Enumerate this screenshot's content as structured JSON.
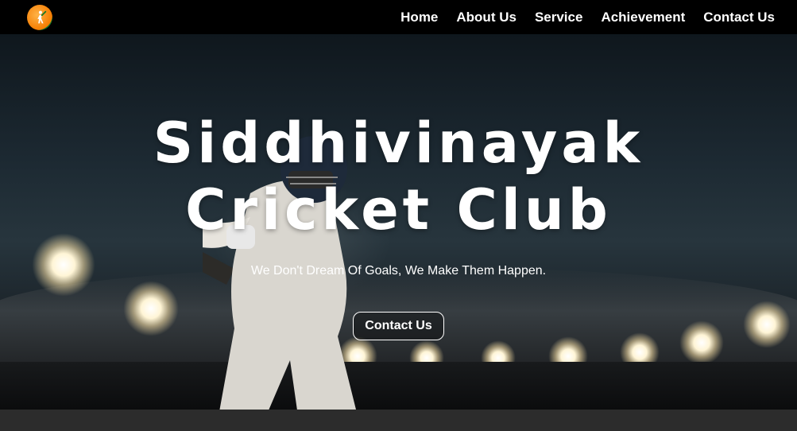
{
  "nav": {
    "logo_icon": "cricket-batsman-icon",
    "links": [
      {
        "label": "Home"
      },
      {
        "label": "About Us"
      },
      {
        "label": "Service"
      },
      {
        "label": "Achievement"
      },
      {
        "label": "Contact Us"
      }
    ]
  },
  "hero": {
    "title_line1": "Siddhivinayak",
    "title_line2": "Cricket Club",
    "tagline": "We Don't Dream Of Goals, We Make Them Happen.",
    "cta_label": "Contact Us"
  },
  "colors": {
    "navbar_bg": "#000000",
    "text": "#ffffff",
    "logo_orange": "#f57c00",
    "logo_green": "#1b7a2b"
  }
}
